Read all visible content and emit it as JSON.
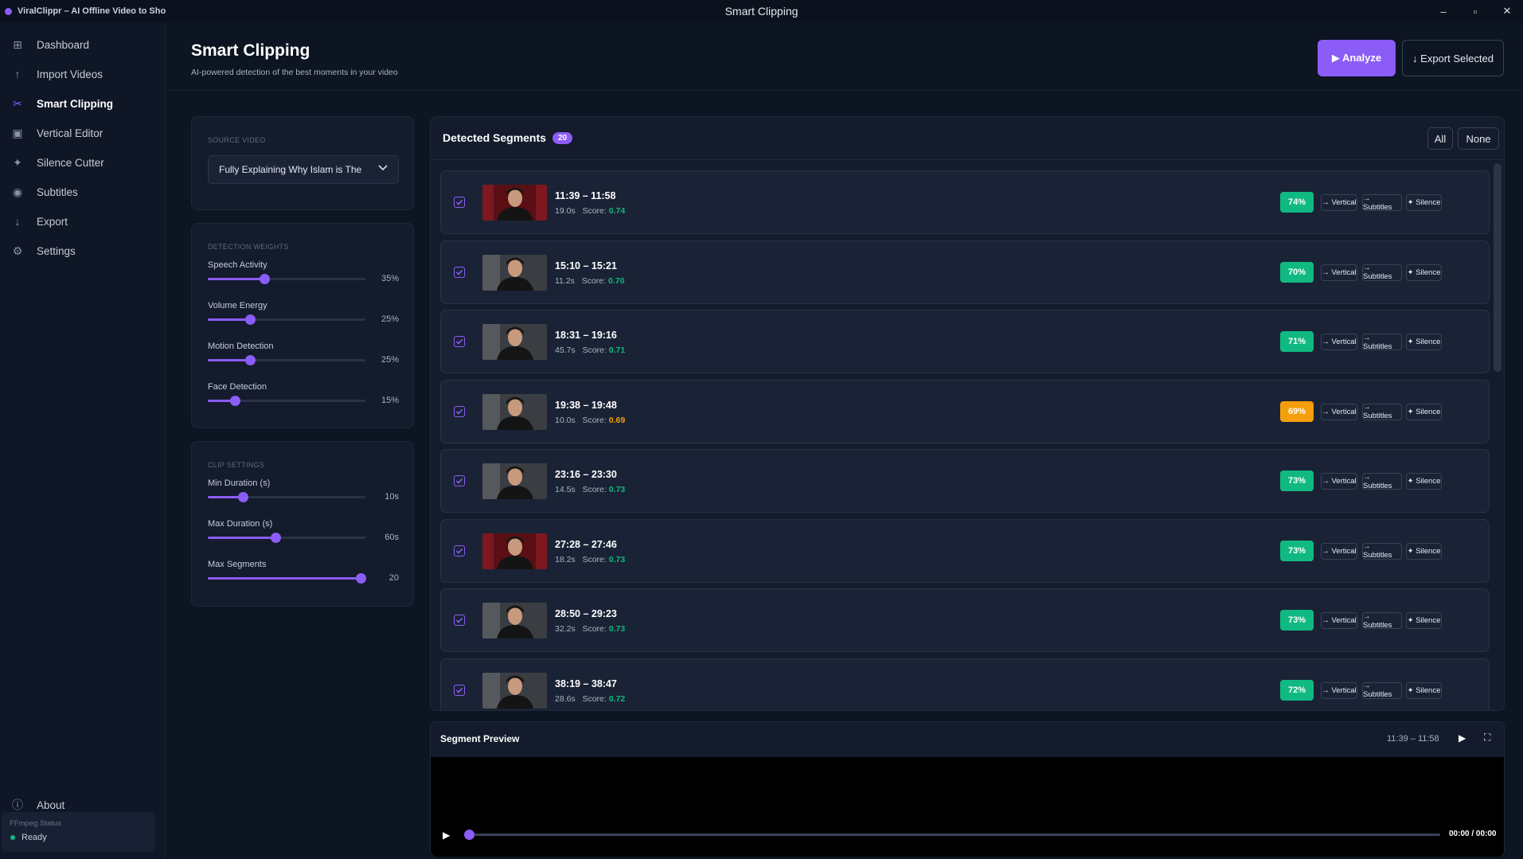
{
  "window": {
    "app_title": "ViralClippr – AI Offline Video to Sho",
    "title": "Smart Clipping",
    "controls": [
      "–",
      "▫",
      "✕"
    ]
  },
  "sidebar": {
    "items": [
      {
        "label": "Dashboard",
        "icon": "grid-icon",
        "glyph": "⊞",
        "active": false
      },
      {
        "label": "Import Videos",
        "icon": "upload-icon",
        "glyph": "↑",
        "active": false
      },
      {
        "label": "Smart Clipping",
        "icon": "scissors-icon",
        "glyph": "✂",
        "active": true
      },
      {
        "label": "Vertical Editor",
        "icon": "vertical-frame-icon",
        "glyph": "▣",
        "active": false
      },
      {
        "label": "Silence Cutter",
        "icon": "sparkle-icon",
        "glyph": "✦",
        "active": false
      },
      {
        "label": "Subtitles",
        "icon": "record-icon",
        "glyph": "◉",
        "active": false
      },
      {
        "label": "Export",
        "icon": "download-icon",
        "glyph": "↓",
        "active": false
      },
      {
        "label": "Settings",
        "icon": "gear-icon",
        "glyph": "⚙",
        "active": false
      }
    ],
    "about": {
      "label": "About",
      "glyph": "ⓘ"
    },
    "ffmpeg": {
      "label": "FFmpeg Status",
      "status": "Ready",
      "status_color": "#10b981"
    }
  },
  "header": {
    "title": "Smart Clipping",
    "subtitle": "AI-powered detection of the best moments in your video",
    "analyze_label": "▶ Analyze",
    "export_label": "↓ Export Selected"
  },
  "source": {
    "label": "SOURCE VIDEO",
    "value": "Fully Explaining Why Islam is The"
  },
  "weights": {
    "label": "DETECTION WEIGHTS",
    "items": [
      {
        "name": "Speech Activity",
        "value": "35%",
        "level": 0.36
      },
      {
        "name": "Volume Energy",
        "value": "25%",
        "level": 0.27
      },
      {
        "name": "Motion Detection",
        "value": "25%",
        "level": 0.27
      },
      {
        "name": "Face Detection",
        "value": "15%",
        "level": 0.17
      }
    ]
  },
  "clip_settings": {
    "label": "CLIP SETTINGS",
    "items": [
      {
        "name": "Min Duration (s)",
        "value": "10s",
        "level": 0.22
      },
      {
        "name": "Max Duration (s)",
        "value": "60s",
        "level": 0.43
      },
      {
        "name": "Max Segments",
        "value": "20",
        "level": 0.97
      }
    ]
  },
  "segments": {
    "title": "Detected Segments",
    "count": "20",
    "all_label": "All",
    "none_label": "None",
    "score_label": "Score:",
    "actions": [
      "→ Vertical",
      "→ Subtitles",
      "✦ Silence"
    ],
    "items": [
      {
        "range": "11:39 – 11:58",
        "duration": "19.0s",
        "score": "0.74",
        "pct": "74%",
        "level": "high",
        "thumb": "red"
      },
      {
        "range": "15:10 – 15:21",
        "duration": "11.2s",
        "score": "0.70",
        "pct": "70%",
        "level": "high",
        "thumb": "grey"
      },
      {
        "range": "18:31 – 19:16",
        "duration": "45.7s",
        "score": "0.71",
        "pct": "71%",
        "level": "high",
        "thumb": "grey"
      },
      {
        "range": "19:38 – 19:48",
        "duration": "10.0s",
        "score": "0.69",
        "pct": "69%",
        "level": "mid",
        "thumb": "grey"
      },
      {
        "range": "23:16 – 23:30",
        "duration": "14.5s",
        "score": "0.73",
        "pct": "73%",
        "level": "high",
        "thumb": "grey"
      },
      {
        "range": "27:28 – 27:46",
        "duration": "18.2s",
        "score": "0.73",
        "pct": "73%",
        "level": "high",
        "thumb": "red"
      },
      {
        "range": "28:50 – 29:23",
        "duration": "32.2s",
        "score": "0.73",
        "pct": "73%",
        "level": "high",
        "thumb": "grey"
      },
      {
        "range": "38:19 – 38:47",
        "duration": "28.6s",
        "score": "0.72",
        "pct": "72%",
        "level": "high",
        "thumb": "grey"
      }
    ]
  },
  "preview": {
    "title": "Segment Preview",
    "range": "11:39 – 11:58",
    "time": "00:00 / 00:00",
    "progress": 0
  },
  "colors": {
    "accent": "#8b5cf6",
    "good": "#10b981",
    "warn": "#f59e0b"
  }
}
